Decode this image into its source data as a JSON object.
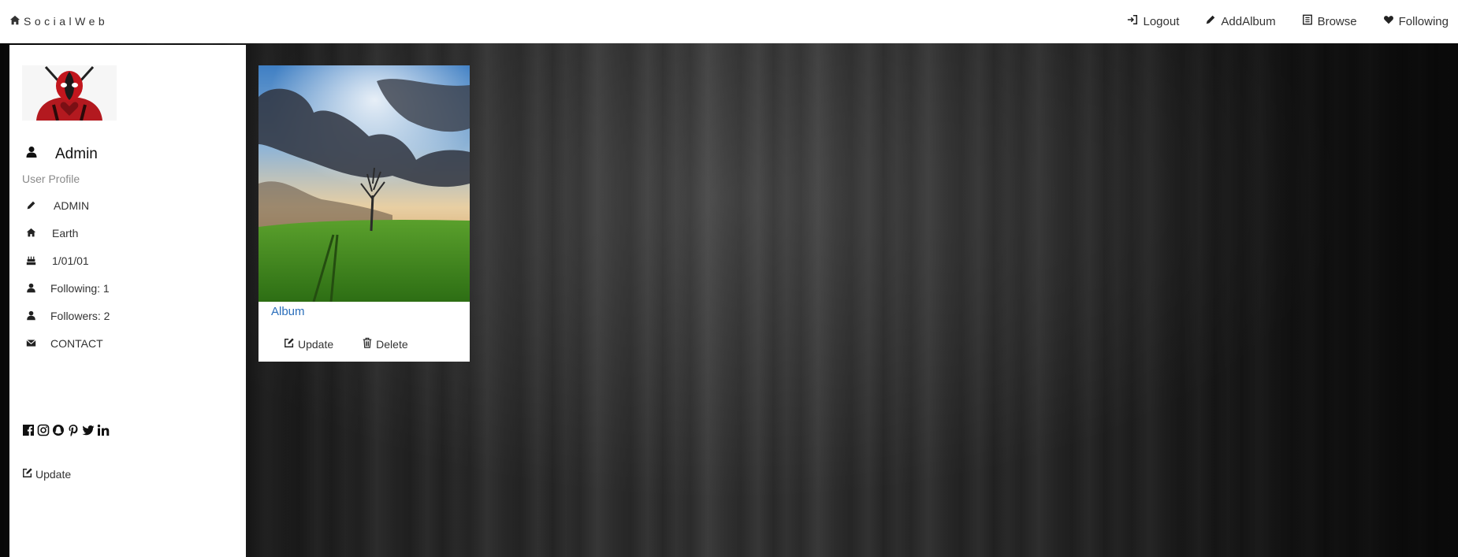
{
  "navbar": {
    "brand": "SocialWeb",
    "brand_icon": "home-icon",
    "links": [
      {
        "label": "Logout",
        "icon": "sign-in-icon"
      },
      {
        "label": "AddAlbum",
        "icon": "pencil-icon"
      },
      {
        "label": "Browse",
        "icon": "list-icon"
      },
      {
        "label": "Following",
        "icon": "heart-icon"
      }
    ]
  },
  "profile": {
    "name": "Admin",
    "subtitle": "User Profile",
    "info": [
      {
        "icon": "pencil-icon",
        "label": "ADMIN"
      },
      {
        "icon": "home-icon",
        "label": "Earth"
      },
      {
        "icon": "cake-icon",
        "label": "1/01/01"
      },
      {
        "icon": "user-icon",
        "label": "Following: 1"
      },
      {
        "icon": "user-icon",
        "label": "Followers: 2"
      },
      {
        "icon": "envelope-icon",
        "label": "CONTACT"
      }
    ],
    "socials": [
      "facebook-icon",
      "instagram-icon",
      "snapchat-icon",
      "pinterest-icon",
      "twitter-icon",
      "linkedin-icon"
    ],
    "update_label": "Update"
  },
  "album": {
    "title": "Album",
    "update_label": "Update",
    "delete_label": "Delete"
  },
  "colors": {
    "link": "#2a6ebb",
    "background_wood": "#3f3f3f"
  }
}
